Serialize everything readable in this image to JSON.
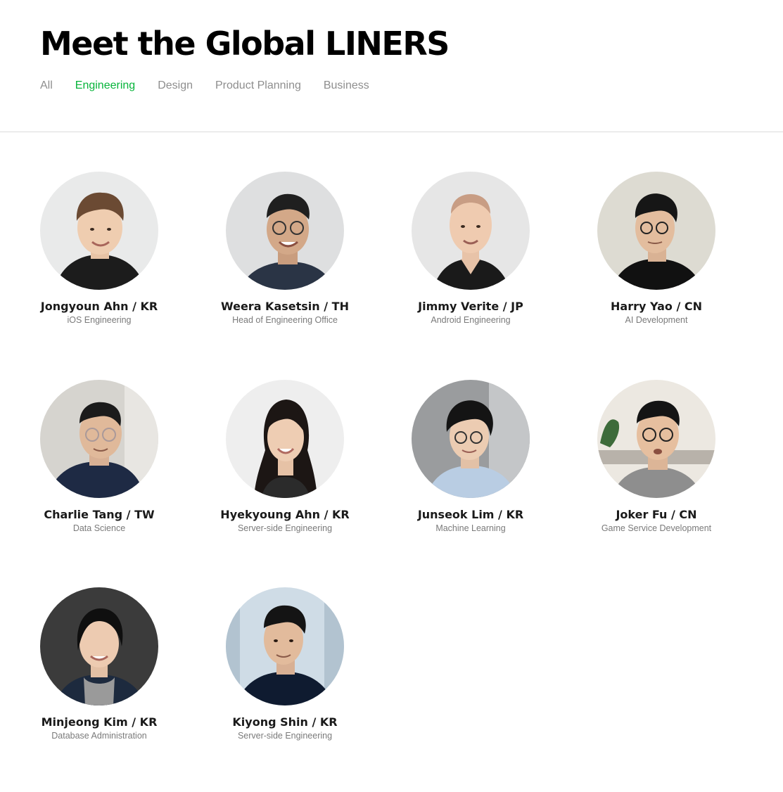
{
  "page": {
    "title": "Meet the Global LINERS"
  },
  "tabs": [
    {
      "label": "All",
      "active": false
    },
    {
      "label": "Engineering",
      "active": true
    },
    {
      "label": "Design",
      "active": false
    },
    {
      "label": "Product Planning",
      "active": false
    },
    {
      "label": "Business",
      "active": false
    }
  ],
  "colors": {
    "accent": "#06b43a",
    "tab_inactive": "#8e8e8e",
    "divider": "#dcdcdc"
  },
  "members": [
    {
      "name": "Jongyoun Ahn / KR",
      "role": "iOS Engineering",
      "icon": "person-photo"
    },
    {
      "name": "Weera Kasetsin / TH",
      "role": "Head of Engineering Office",
      "icon": "person-photo"
    },
    {
      "name": "Jimmy Verite / JP",
      "role": "Android Engineering",
      "icon": "person-photo"
    },
    {
      "name": "Harry Yao / CN",
      "role": "AI Development",
      "icon": "person-photo"
    },
    {
      "name": "Charlie Tang / TW",
      "role": "Data Science",
      "icon": "person-photo"
    },
    {
      "name": "Hyekyoung Ahn / KR",
      "role": "Server-side Engineering",
      "icon": "person-photo"
    },
    {
      "name": "Junseok Lim / KR",
      "role": "Machine Learning",
      "icon": "person-photo"
    },
    {
      "name": "Joker Fu / CN",
      "role": "Game Service Development",
      "icon": "person-photo"
    },
    {
      "name": "Minjeong Kim / KR",
      "role": "Database Administration",
      "icon": "person-photo"
    },
    {
      "name": "Kiyong Shin / KR",
      "role": "Server-side Engineering",
      "icon": "person-photo"
    }
  ]
}
